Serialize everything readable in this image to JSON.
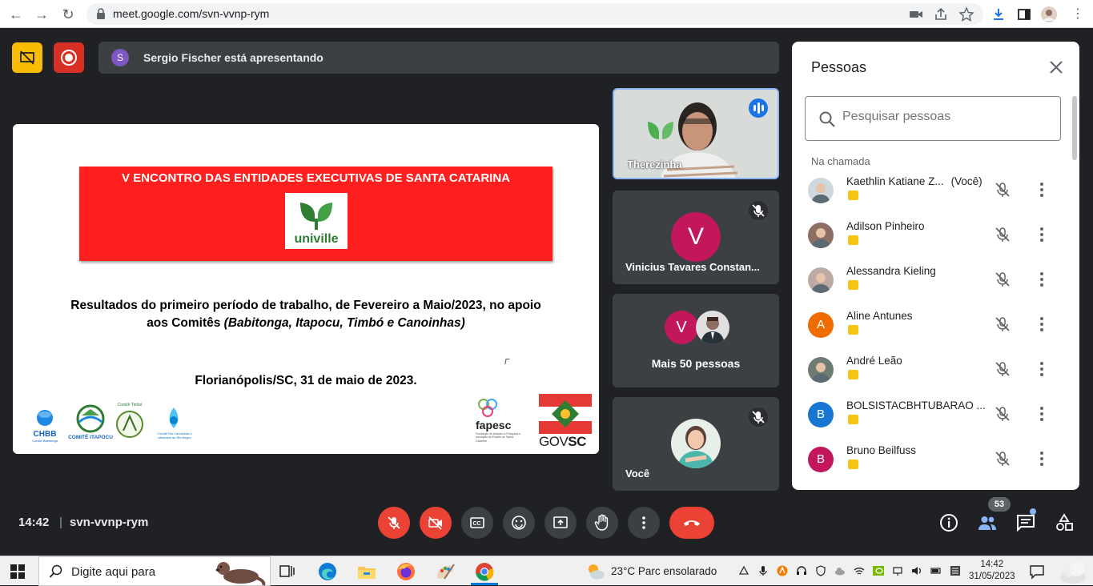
{
  "browser": {
    "url": "meet.google.com/svn-vvnp-rym"
  },
  "banner": {
    "presenter_initial": "S",
    "presenting_text": "Sergio Fischer está apresentando"
  },
  "slide": {
    "header": "V ENCONTRO DAS ENTIDADES EXECUTIVAS DE SANTA CATARINA",
    "logo_text": "univille",
    "results_line1": "Resultados do primeiro período de trabalho, de Fevereiro a Maio/2023, no apoio",
    "results_line2_prefix": "aos Comitês ",
    "results_line2_italic": "(Babitonga, Itapocu, Timbó e Canoinhas)",
    "city": "Florianópolis/SC, 31 de maio de 2023.",
    "logos": {
      "chbb": "CHBB",
      "chbb_sub": "Comitê Babitonga",
      "itapocu": "COMITÊ ITAPOCU",
      "timbo": "Comitê Timbó",
      "canoinhas": "Comitê Rio Canoinhas e afluentes do Rio Negro",
      "fapesc": "fapesc",
      "fapesc_sub": "Fundação de Amparo à Pesquisa e Inovação do Estado de Santa Catarina",
      "govsc_a": "GOV",
      "govsc_b": "SC"
    }
  },
  "tiles": {
    "t1_name": "Therezinha",
    "t2_initial": "V",
    "t2_name": "Vinicius Tavares Constan...",
    "t3_initial": "V",
    "t3_text": "Mais 50 pessoas",
    "t4_name": "Você"
  },
  "panel": {
    "title": "Pessoas",
    "search_placeholder": "Pesquisar pessoas",
    "section": "Na chamada",
    "people": [
      {
        "name": "Kaethlin Katiane Z...",
        "suffix": "(Você)",
        "initial": "",
        "color": "#cfd8dc"
      },
      {
        "name": "Adilson Pinheiro",
        "suffix": "",
        "initial": "",
        "color": "#8d6e63"
      },
      {
        "name": "Alessandra Kieling",
        "suffix": "",
        "initial": "",
        "color": "#bcaaa4"
      },
      {
        "name": "Aline Antunes",
        "suffix": "",
        "initial": "A",
        "color": "#ef6c00"
      },
      {
        "name": "André Leão",
        "suffix": "",
        "initial": "",
        "color": "#6d7b74"
      },
      {
        "name": "BOLSISTACBHTUBARAO ...",
        "suffix": "",
        "initial": "B",
        "color": "#1976d2"
      },
      {
        "name": "Bruno Beilfuss",
        "suffix": "",
        "initial": "B",
        "color": "#c2185b"
      }
    ]
  },
  "controls": {
    "time": "14:42",
    "separator": "|",
    "meeting_code": "svn-vvnp-rym",
    "participant_count": "53"
  },
  "taskbar": {
    "search_text": "Digite aqui para",
    "weather": "23°C  Parc ensolarado",
    "clock_time": "14:42",
    "clock_date": "31/05/2023"
  },
  "colors": {
    "meet_bg": "#202124",
    "tile_bg": "#3c4043",
    "danger": "#ea4335",
    "accent_blue": "#1a73e8",
    "slide_red": "#ff1f1f"
  }
}
